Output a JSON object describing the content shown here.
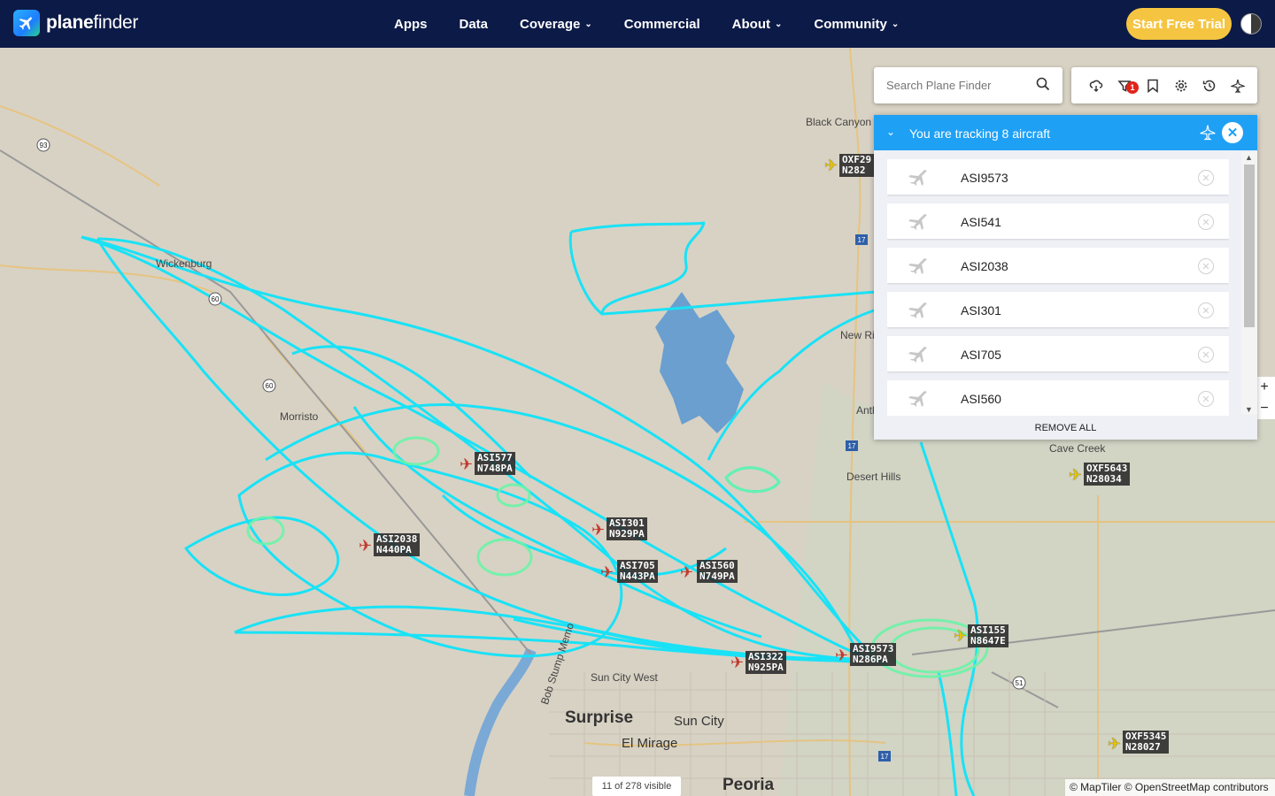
{
  "brand": {
    "name_prefix": "plane",
    "name_suffix": "finder"
  },
  "nav": {
    "items": [
      {
        "label": "Apps",
        "dropdown": false
      },
      {
        "label": "Data",
        "dropdown": false
      },
      {
        "label": "Coverage",
        "dropdown": true
      },
      {
        "label": "Commercial",
        "dropdown": false
      },
      {
        "label": "About",
        "dropdown": true
      },
      {
        "label": "Community",
        "dropdown": true
      }
    ],
    "cta_label": "Start Free Trial"
  },
  "search": {
    "placeholder": "Search Plane Finder"
  },
  "toolbar": {
    "filter_badge": "1"
  },
  "tracking": {
    "title": "You are tracking 8 aircraft",
    "aircraft": [
      "ASI9573",
      "ASI541",
      "ASI2038",
      "ASI301",
      "ASI705",
      "ASI560"
    ],
    "remove_all_label": "REMOVE ALL"
  },
  "map": {
    "places": {
      "black_canyon": "Black Canyon C",
      "wickenburg": "Wickenburg",
      "morristown": "Morristo",
      "new_river": "New Riv",
      "anthem": "Anth",
      "desert_hills": "Desert Hills",
      "cave_creek": "Cave Creek",
      "surprise": "Surprise",
      "sun_city": "Sun City",
      "sun_city_west": "Sun City West",
      "el_mirage": "El Mirage",
      "peoria": "Peoria",
      "bob_stump": "Bob Stump Memo"
    },
    "aircraft_labels": [
      {
        "callsign": "ASI577",
        "reg": "N748PA",
        "color": "red"
      },
      {
        "callsign": "ASI2038",
        "reg": "N440PA",
        "color": "red"
      },
      {
        "callsign": "ASI301",
        "reg": "N929PA",
        "color": "red"
      },
      {
        "callsign": "ASI705",
        "reg": "N443PA",
        "color": "red"
      },
      {
        "callsign": "ASI560",
        "reg": "N749PA",
        "color": "red"
      },
      {
        "callsign": "ASI322",
        "reg": "N925PA",
        "color": "red"
      },
      {
        "callsign": "ASI9573",
        "reg": "N286PA",
        "color": "red"
      },
      {
        "callsign": "ASI155",
        "reg": "N8647E",
        "color": "yellow"
      },
      {
        "callsign": "OXF29",
        "reg": "N282",
        "color": "yellow"
      },
      {
        "callsign": "OXF5643",
        "reg": "N28034",
        "color": "yellow"
      },
      {
        "callsign": "OXF5345",
        "reg": "N28027",
        "color": "yellow"
      }
    ],
    "route_shields": [
      "93",
      "60",
      "60",
      "17",
      "17",
      "17",
      "51"
    ],
    "visible_count": "11 of 278 visible",
    "attribution": "© MapTiler © OpenStreetMap contributors"
  },
  "colors": {
    "nav_bg": "#0c1a47",
    "cta": "#f5c542",
    "panel_head": "#1ea0f5",
    "track_cyan": "#19e2f6",
    "track_green": "#6cf4a8"
  }
}
